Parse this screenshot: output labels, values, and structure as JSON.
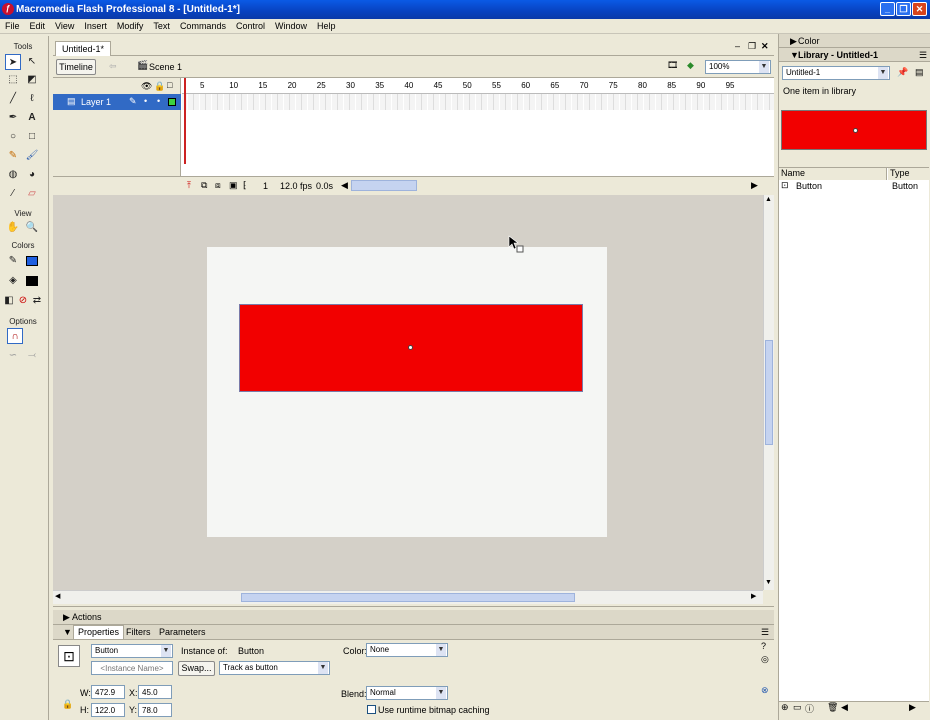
{
  "app": {
    "title": "Macromedia Flash Professional 8 - [Untitled-1*]"
  },
  "menu": [
    "File",
    "Edit",
    "View",
    "Insert",
    "Modify",
    "Text",
    "Commands",
    "Control",
    "Window",
    "Help"
  ],
  "tools": {
    "tools_label": "Tools",
    "view_label": "View",
    "colors_label": "Colors",
    "options_label": "Options"
  },
  "document": {
    "tab": "Untitled-1*",
    "timeline_button": "Timeline",
    "scene": "Scene 1",
    "zoom": "100%"
  },
  "timeline": {
    "layer_name": "Layer 1",
    "frame_numbers": [
      "5",
      "10",
      "15",
      "20",
      "25",
      "30",
      "35",
      "40",
      "45",
      "50",
      "55",
      "60",
      "65",
      "70",
      "75",
      "80",
      "85",
      "90",
      "95"
    ],
    "current_frame": "1",
    "fps": "12.0 fps",
    "elapsed": "0.0s"
  },
  "panels": {
    "actions": "Actions",
    "properties": "Properties",
    "filters": "Filters",
    "parameters": "Parameters"
  },
  "properties": {
    "symbol_type": "Button",
    "instance_name_placeholder": "<Instance Name>",
    "instance_of_label": "Instance of:",
    "instance_of": "Button",
    "swap_label": "Swap...",
    "track": "Track as button",
    "color_label": "Color:",
    "color_value": "None",
    "blend_label": "Blend:",
    "blend_value": "Normal",
    "cache_label": "Use runtime bitmap caching",
    "w_label": "W:",
    "w": "472.9",
    "x_label": "X:",
    "x": "45.0",
    "h_label": "H:",
    "h": "122.0",
    "y_label": "Y:",
    "y": "78.0"
  },
  "right": {
    "color_panel": "Color",
    "library_title": "Library - Untitled-1",
    "library_doc": "Untitled-1",
    "item_count": "One item in library",
    "col_name": "Name",
    "col_type": "Type",
    "item_name": "Button",
    "item_type": "Button"
  },
  "colors": {
    "accent": "#316ac5",
    "shape_fill": "#f20000",
    "stage": "#f5f6f4",
    "pasteboard": "#d4d0c8"
  }
}
